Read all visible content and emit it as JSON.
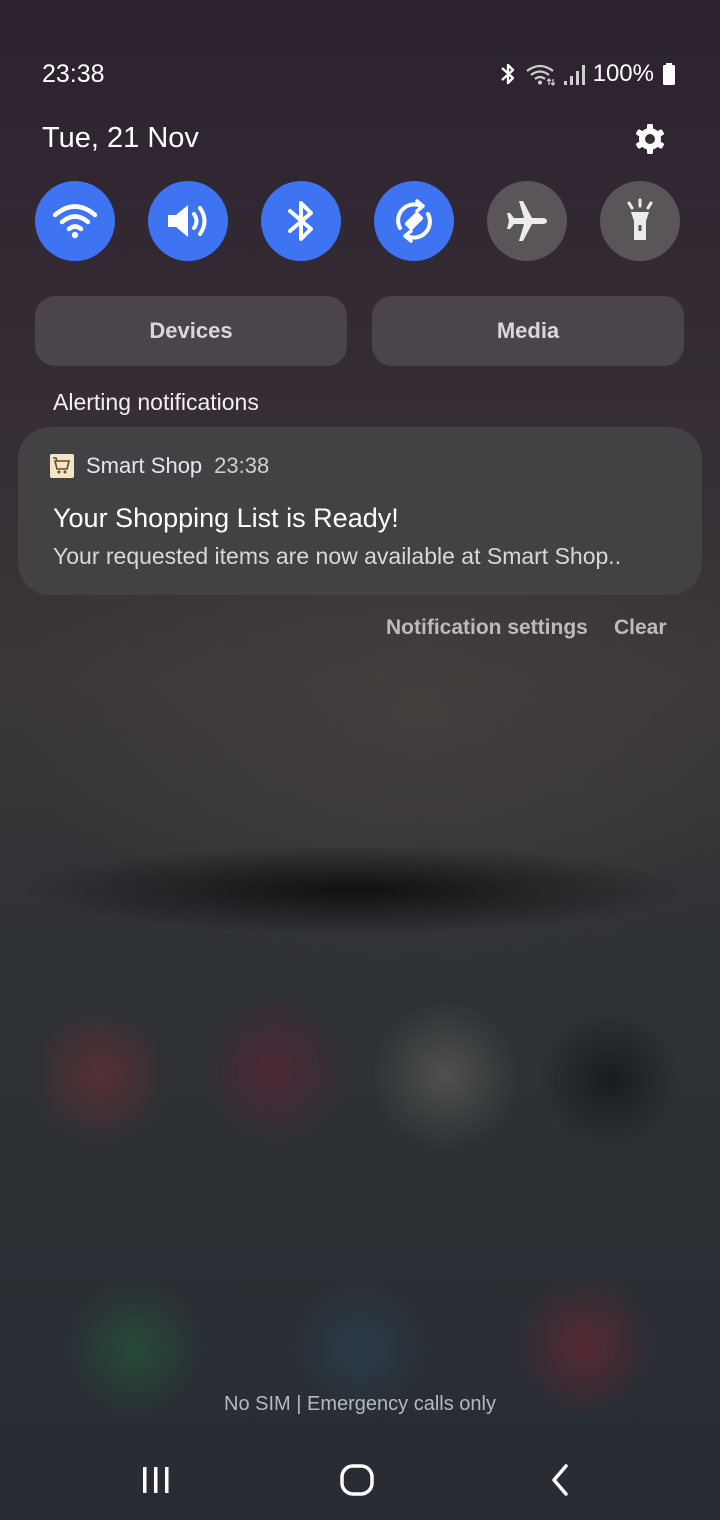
{
  "status_bar": {
    "time": "23:38",
    "battery": "100%",
    "icons": [
      "bluetooth-icon",
      "wifi-icon",
      "signal-icon",
      "battery-icon"
    ]
  },
  "header": {
    "date": "Tue, 21 Nov",
    "settings_icon": "gear-icon"
  },
  "quick_settings": [
    {
      "name": "wifi",
      "icon": "wifi-icon",
      "state": "on"
    },
    {
      "name": "sound",
      "icon": "sound-icon",
      "state": "on"
    },
    {
      "name": "bluetooth",
      "icon": "bluetooth-icon",
      "state": "on"
    },
    {
      "name": "auto-rotate",
      "icon": "rotate-icon",
      "state": "on"
    },
    {
      "name": "airplane-mode",
      "icon": "airplane-icon",
      "state": "off"
    },
    {
      "name": "flashlight",
      "icon": "flashlight-icon",
      "state": "off"
    }
  ],
  "pills": {
    "devices": "Devices",
    "media": "Media"
  },
  "section_label": "Alerting notifications",
  "notification": {
    "app_name": "Smart Shop",
    "time": "23:38",
    "title": "Your Shopping List is Ready!",
    "body": "Your requested items are now available at Smart Shop.."
  },
  "actions": {
    "settings": "Notification settings",
    "clear": "Clear"
  },
  "footer_status": "No SIM | Emergency calls only",
  "colors": {
    "accent": "#3e73f2",
    "tile_off": "#5a5558",
    "card": "#434144"
  }
}
